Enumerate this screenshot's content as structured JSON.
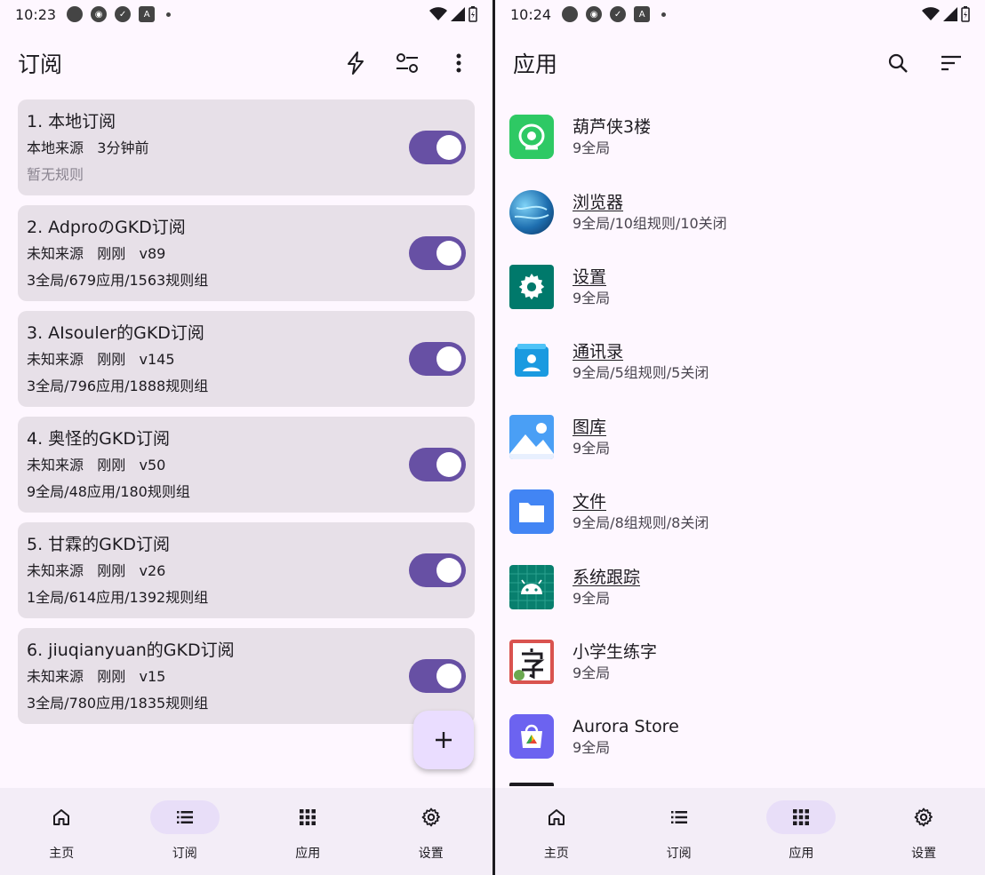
{
  "left": {
    "status": {
      "time": "10:23"
    },
    "header": {
      "title": "订阅"
    },
    "subscriptions": [
      {
        "name": "1. 本地订阅",
        "meta": "本地来源   3分钟前",
        "stats": "暂无规则",
        "enabled": true
      },
      {
        "name": "2. AdproのGKD订阅",
        "meta": "未知来源   刚刚   v89",
        "stats": "3全局/679应用/1563规则组",
        "enabled": true
      },
      {
        "name": "3. AIsouler的GKD订阅",
        "meta": "未知来源   刚刚   v145",
        "stats": "3全局/796应用/1888规则组",
        "enabled": true
      },
      {
        "name": "4. 奥怪的GKD订阅",
        "meta": "未知来源   刚刚   v50",
        "stats": "9全局/48应用/180规则组",
        "enabled": true
      },
      {
        "name": "5. 甘霖的GKD订阅",
        "meta": "未知来源   刚刚   v26",
        "stats": "1全局/614应用/1392规则组",
        "enabled": true
      },
      {
        "name": "6. jiuqianyuan的GKD订阅",
        "meta": "未知来源   刚刚   v15",
        "stats": "3全局/780应用/1835规则组",
        "enabled": true
      }
    ],
    "fab_icon": "plus-icon",
    "nav": [
      {
        "label": "主页",
        "icon": "home-icon",
        "active": false
      },
      {
        "label": "订阅",
        "icon": "list-icon",
        "active": true
      },
      {
        "label": "应用",
        "icon": "apps-grid-icon",
        "active": false
      },
      {
        "label": "设置",
        "icon": "gear-icon",
        "active": false
      }
    ]
  },
  "right": {
    "status": {
      "time": "10:24"
    },
    "header": {
      "title": "应用"
    },
    "apps": [
      {
        "name": "葫芦侠3楼",
        "sub": "9全局",
        "icon": "huluxia-icon",
        "color": "#2ec964"
      },
      {
        "name": "浏览器",
        "sub": "9全局/10组规则/10关闭",
        "icon": "globe-icon",
        "color": "#1e6fb0"
      },
      {
        "name": "设置",
        "sub": "9全局",
        "icon": "settings-gear-icon",
        "color": "#00796b"
      },
      {
        "name": "通讯录",
        "sub": "9全局/5组规则/5关闭",
        "icon": "contacts-icon",
        "color": "#1a9ae0"
      },
      {
        "name": "图库",
        "sub": "9全局",
        "icon": "gallery-icon",
        "color": "#4a9ff5"
      },
      {
        "name": "文件",
        "sub": "9全局/8组规则/8关闭",
        "icon": "folder-icon",
        "color": "#4285f4"
      },
      {
        "name": "系统跟踪",
        "sub": "9全局",
        "icon": "android-icon",
        "color": "#087f6e"
      },
      {
        "name": "小学生练字",
        "sub": "9全局",
        "icon": "zi-character-icon",
        "color": "#d9534f"
      },
      {
        "name": "Aurora Store",
        "sub": "9全局",
        "icon": "aurora-store-icon",
        "color": "#6c63f0"
      }
    ],
    "nav": [
      {
        "label": "主页",
        "icon": "home-icon",
        "active": false
      },
      {
        "label": "订阅",
        "icon": "list-icon",
        "active": false
      },
      {
        "label": "应用",
        "icon": "apps-grid-icon",
        "active": true
      },
      {
        "label": "设置",
        "icon": "gear-icon",
        "active": false
      }
    ]
  }
}
